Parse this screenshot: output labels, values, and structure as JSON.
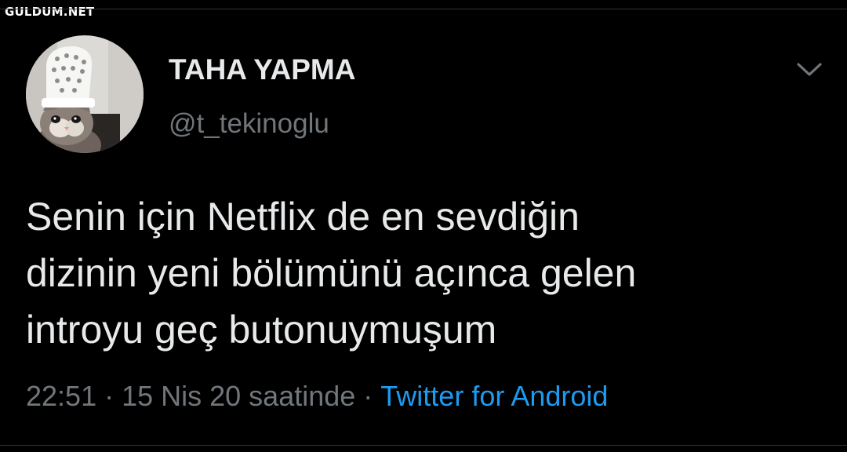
{
  "watermark": "GULDUM.NET",
  "author": {
    "name": "TAHA YAPMA",
    "handle": "@t_tekinoglu"
  },
  "tweet": {
    "lines": [
      "Senin için Netflix de en sevdiğin",
      "dizinin yeni bölümünü açınca gelen",
      "introyu geç butonuymuşum"
    ]
  },
  "meta": {
    "time": "22:51",
    "separator": "·",
    "date": "15 Nis 20 saatinde",
    "source": "Twitter for Android"
  },
  "icons": {
    "more": "chevron-down-icon",
    "avatar": "cat-in-crocs-hat-avatar"
  },
  "colors": {
    "background": "#000000",
    "text": "#e7e9ea",
    "muted": "#71767b",
    "link": "#1d9bf0",
    "divider": "#2f3336"
  }
}
